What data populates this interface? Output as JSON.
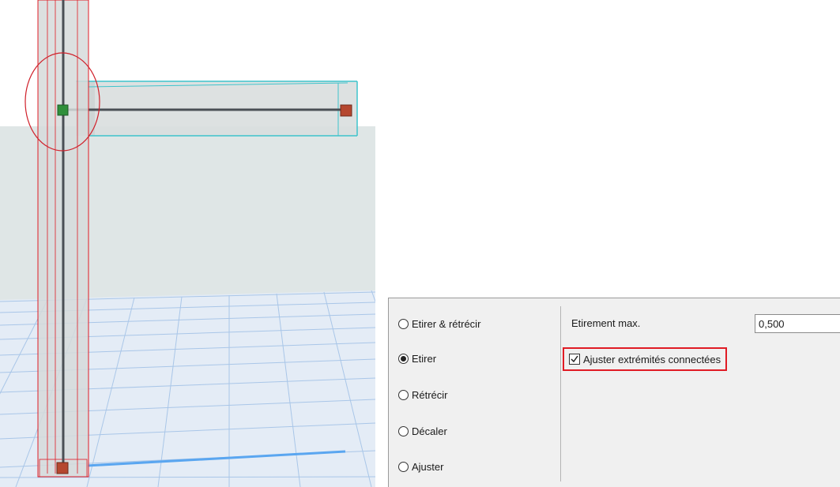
{
  "stretch_options": {
    "radios": [
      {
        "label": "Etirer & rétrécir",
        "checked": false
      },
      {
        "label": "Etirer",
        "checked": true
      },
      {
        "label": "Rétrécir",
        "checked": false
      },
      {
        "label": "Décaler",
        "checked": false
      },
      {
        "label": "Ajuster",
        "checked": false
      }
    ],
    "max_stretch_label": "Etirement max.",
    "max_stretch_value": "0,500",
    "adjust_connected_ends_label": "Ajuster extrémités connectées",
    "adjust_connected_ends_checked": true
  },
  "colors": {
    "selection_outline": "#e01b24",
    "highlight_beam": "#3ec4cc",
    "node_green": "#2f8f3a",
    "node_orange": "#b5472f",
    "grid_line": "#a9c6e8"
  }
}
